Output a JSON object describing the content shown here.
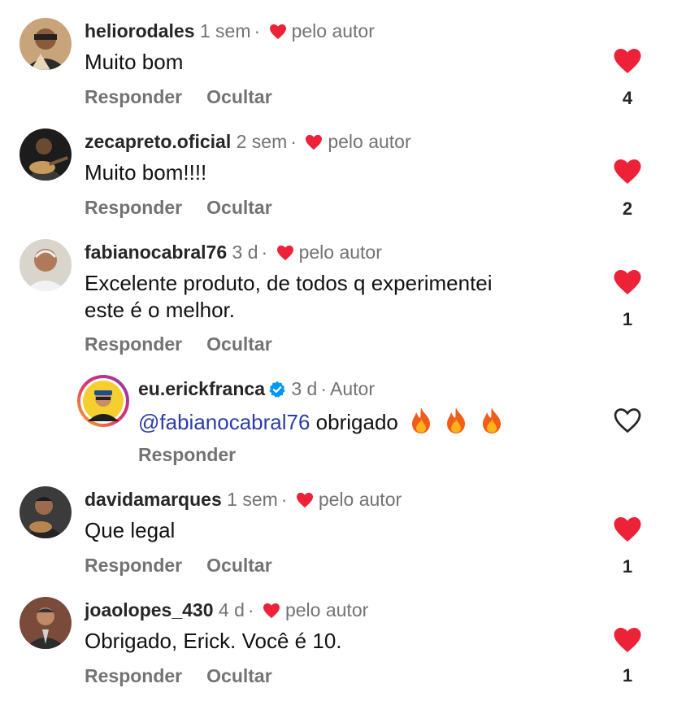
{
  "colors": {
    "like_red": "#ed2238",
    "muted": "#737373",
    "mention": "#2c3da8",
    "verified_blue": "#0095f6"
  },
  "icons": {
    "like": "heart-filled-icon",
    "like_empty": "heart-outline-icon",
    "verified": "verified-badge-icon",
    "fire": "fire-emoji-icon"
  },
  "comments": [
    {
      "user": "heliorodales",
      "time": "1 sem",
      "liked_label": "pelo autor",
      "text": "Muito bom",
      "reply": "Responder",
      "hide": "Ocultar",
      "likes": "4"
    },
    {
      "user": "zecapreto.oficial",
      "time": "2 sem",
      "liked_label": "pelo autor",
      "text": "Muito bom!!!!",
      "reply": "Responder",
      "hide": "Ocultar",
      "likes": "2"
    },
    {
      "user": "fabianocabral76",
      "time": "3 d",
      "liked_label": "pelo autor",
      "text_line1": "Excelente produto, de todos q experimentei",
      "text_line2": "este é o melhor.",
      "reply": "Responder",
      "hide": "Ocultar",
      "likes": "1"
    },
    {
      "user": "davidamarques",
      "time": "1 sem",
      "liked_label": "pelo autor",
      "text": "Que legal",
      "reply": "Responder",
      "hide": "Ocultar",
      "likes": "1"
    },
    {
      "user": "joaolopes_430",
      "time": "4 d",
      "liked_label": "pelo autor",
      "text": "Obrigado, Erick. Você é 10.",
      "reply": "Responder",
      "hide": "Ocultar",
      "likes": "1"
    }
  ],
  "author_reply": {
    "user": "eu.erickfranca",
    "time": "3 d",
    "role": "Autor",
    "mention": "@fabianocabral76",
    "text": "obrigado",
    "reply": "Responder"
  }
}
